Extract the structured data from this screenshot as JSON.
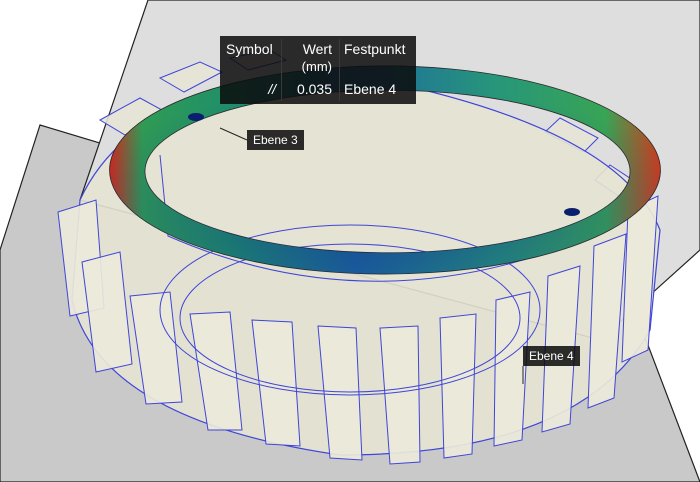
{
  "tolerance_table": {
    "headers": {
      "symbol": "Symbol",
      "value": "Wert",
      "value_unit": "(mm)",
      "datum": "Festpunkt"
    },
    "row": {
      "symbol": "//",
      "value": "0.035",
      "datum": "Ebene 4"
    }
  },
  "plane_labels": {
    "upper": "Ebene 3",
    "lower": "Ebene 4"
  },
  "colors": {
    "plane": "#c9c9c9",
    "gear_body": "#e5e3d2",
    "edge": "#3f45d8",
    "heatmap_low": "#123a9a",
    "heatmap_mid": "#1f9a63",
    "heatmap_high": "#d2261d"
  },
  "icons": {
    "parallelism": "parallelism-symbol"
  }
}
